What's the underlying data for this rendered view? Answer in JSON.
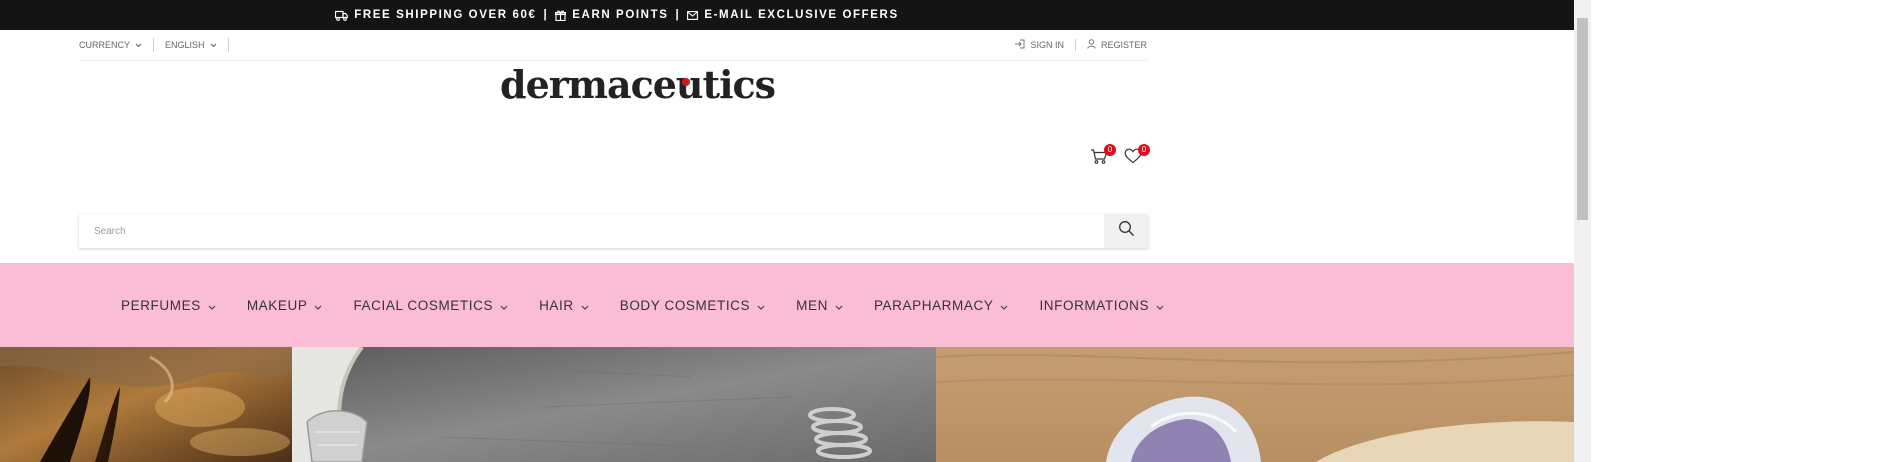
{
  "promo": {
    "shipping": "FREE SHIPPING OVER 60€",
    "points": "EARN POINTS",
    "offers": "E-MAIL EXCLUSIVE OFFERS",
    "separator": "|"
  },
  "utility": {
    "currency_label": "CURRENCY",
    "language_label": "ENGLISH",
    "sign_in": "SIGN IN",
    "register": "REGISTER"
  },
  "brand": {
    "name": "dermaceutics",
    "dot_color": "#d7131f"
  },
  "header_icons": {
    "cart_count": "0",
    "wishlist_count": "0",
    "badge_color": "#e10b1a"
  },
  "search": {
    "placeholder": "Search"
  },
  "nav": {
    "background": "#fbbdd5",
    "items": [
      {
        "label": "PERFUMES"
      },
      {
        "label": "MAKEUP"
      },
      {
        "label": "FACIAL COSMETICS"
      },
      {
        "label": "HAIR"
      },
      {
        "label": "BODY COSMETICS"
      },
      {
        "label": "MEN"
      },
      {
        "label": "PARAPHARMACY"
      },
      {
        "label": "INFORMATIONS"
      }
    ]
  },
  "icons": {
    "truck": "truck-icon",
    "gift": "gift-icon",
    "mail": "mail-icon",
    "chevron": "chevron-down-icon",
    "sign_in": "sign-in-icon",
    "user": "user-icon",
    "cart": "cart-icon",
    "heart": "heart-icon",
    "search": "search-icon"
  }
}
